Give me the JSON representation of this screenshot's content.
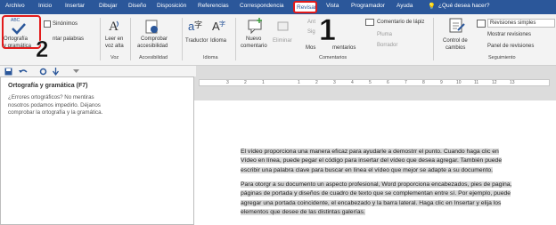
{
  "tabs": [
    "Archivo",
    "Inicio",
    "Insertar",
    "Dibujar",
    "Diseño",
    "Disposición",
    "Referencias",
    "Correspondencia",
    "Revisar",
    "Vista",
    "Programador",
    "Ayuda"
  ],
  "help_search": "¿Qué desea hacer?",
  "ribbon": {
    "abc_label": "ABC",
    "orto_label_1": "Ortografía",
    "orto_label_2": "y gramática",
    "sinonimos": "Sinónimos",
    "contar_palabras": "ntar palabras",
    "leer_1": "Leer en",
    "leer_2": "voz alta",
    "comprobar_1": "Comprobar",
    "comprobar_2": "accesibilidad",
    "traductor": "Traductor",
    "idioma": "Idioma",
    "nuevo_1": "Nuevo",
    "nuevo_2": "comentario",
    "eliminar": "Eliminar",
    "ant": "Ant",
    "sig": "Sig",
    "mos": "Mos",
    "mentarios": "mentarios",
    "comentario_lapiz": "Comentario de lápiz",
    "pluma": "Pluma",
    "borrador": "Borrador",
    "control_1": "Control de",
    "control_2": "cambios",
    "revisiones_simples": "Revisiones simples",
    "mostrar_revisiones": "Mostrar revisiones",
    "panel_revisiones": "Panel de revisiones",
    "groups": {
      "voz": "Voz",
      "accesibilidad": "Accesibilidad",
      "idioma": "Idioma",
      "comentarios": "Comentarios",
      "seguimiento": "Seguimiento"
    }
  },
  "tooltip": {
    "title": "Ortografía y gramática (F7)",
    "description": "¿Errores ortográficos? No mentiras nosotros podamos impedirlo. Déjanos comprobar la ortografía y la gramática."
  },
  "ruler_marks": [
    "3",
    "2",
    "1",
    "1",
    "2",
    "3",
    "4",
    "5",
    "6",
    "7",
    "8",
    "9",
    "10",
    "11",
    "12",
    "13"
  ],
  "document": {
    "lines_p1": [
      "El vídeo proporciona una manera eficaz para ayudarle a demostrr el punto. Cuando haga clic en",
      "Vídeo en línea, puede pegar el código para insertar del vídeo que desea agregar. También puede",
      "escribir una palabra clave para buscar en línea el vídeo que mejor se adapte a su documento."
    ],
    "lines_p2": [
      "Para otorgr a su documento un aspecto profesional, Word proporciona encabezados, pies de pagina,",
      "páginas de portada y diseños de cuadro de texto que se complementan entre sí. Por ejemplo, puede",
      "agregar una portada coincidente, el encabezado y la barra lateral. Haga clic en Insertar y elija los",
      "elementos que desee de las distintas galerías."
    ]
  },
  "annotations": [
    "1",
    "2"
  ],
  "colors": {
    "accent": "#2b579a",
    "highlight": "#e21b1b"
  }
}
